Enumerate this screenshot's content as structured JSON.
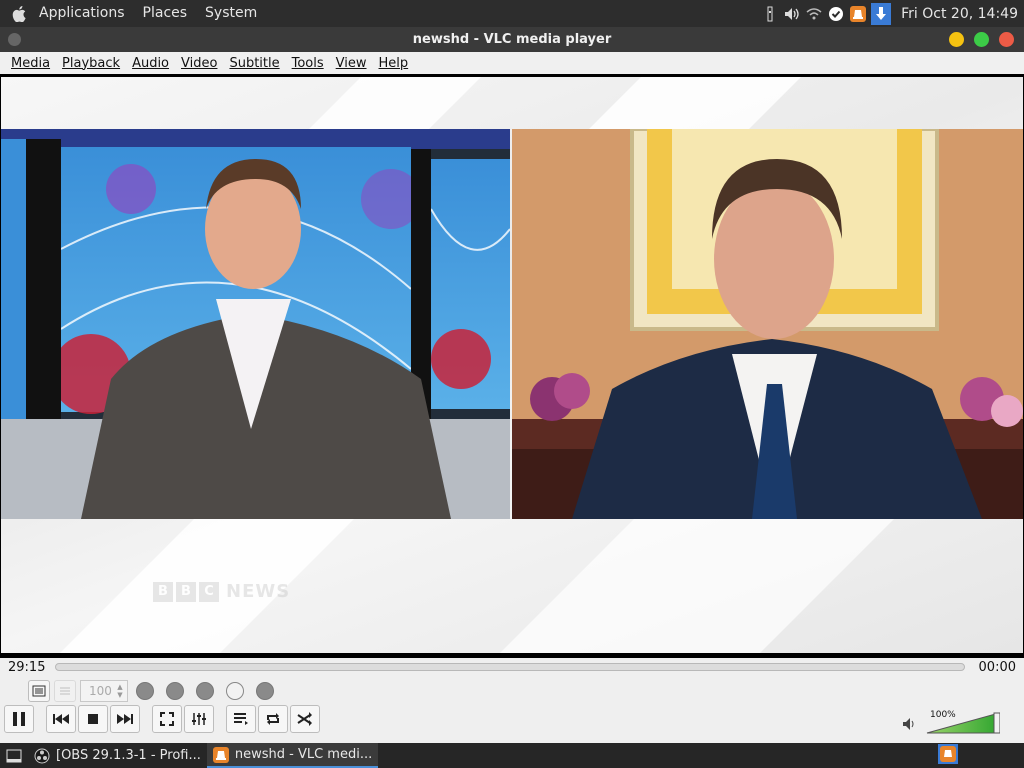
{
  "top_panel": {
    "menus": [
      "Applications",
      "Places",
      "System"
    ],
    "clock": "Fri Oct 20, 14:49",
    "tray_icons": [
      "display-icon",
      "volume-icon",
      "wifi-icon",
      "check-icon",
      "vlc-tray-icon",
      "download-icon"
    ]
  },
  "window": {
    "title": "newshd - VLC media player",
    "controls_colors": {
      "minimize": "#f5c211",
      "maximize": "#3ccc47",
      "close": "#ed5b46"
    }
  },
  "menubar": {
    "items": [
      "Media",
      "Playback",
      "Audio",
      "Video",
      "Subtitle",
      "Tools",
      "View",
      "Help"
    ]
  },
  "video": {
    "logo_letters": [
      "B",
      "B",
      "C"
    ],
    "logo_word": "NEWS"
  },
  "controls": {
    "elapsed": "29:15",
    "total": "00:00",
    "speed_value": "100",
    "volume_percent": "100%",
    "volume_level": 1.0
  },
  "taskbar": {
    "tasks": [
      {
        "label": "[OBS 29.1.3-1 - Profi...",
        "active": false
      },
      {
        "label": "newshd - VLC medi...",
        "active": true
      }
    ]
  }
}
